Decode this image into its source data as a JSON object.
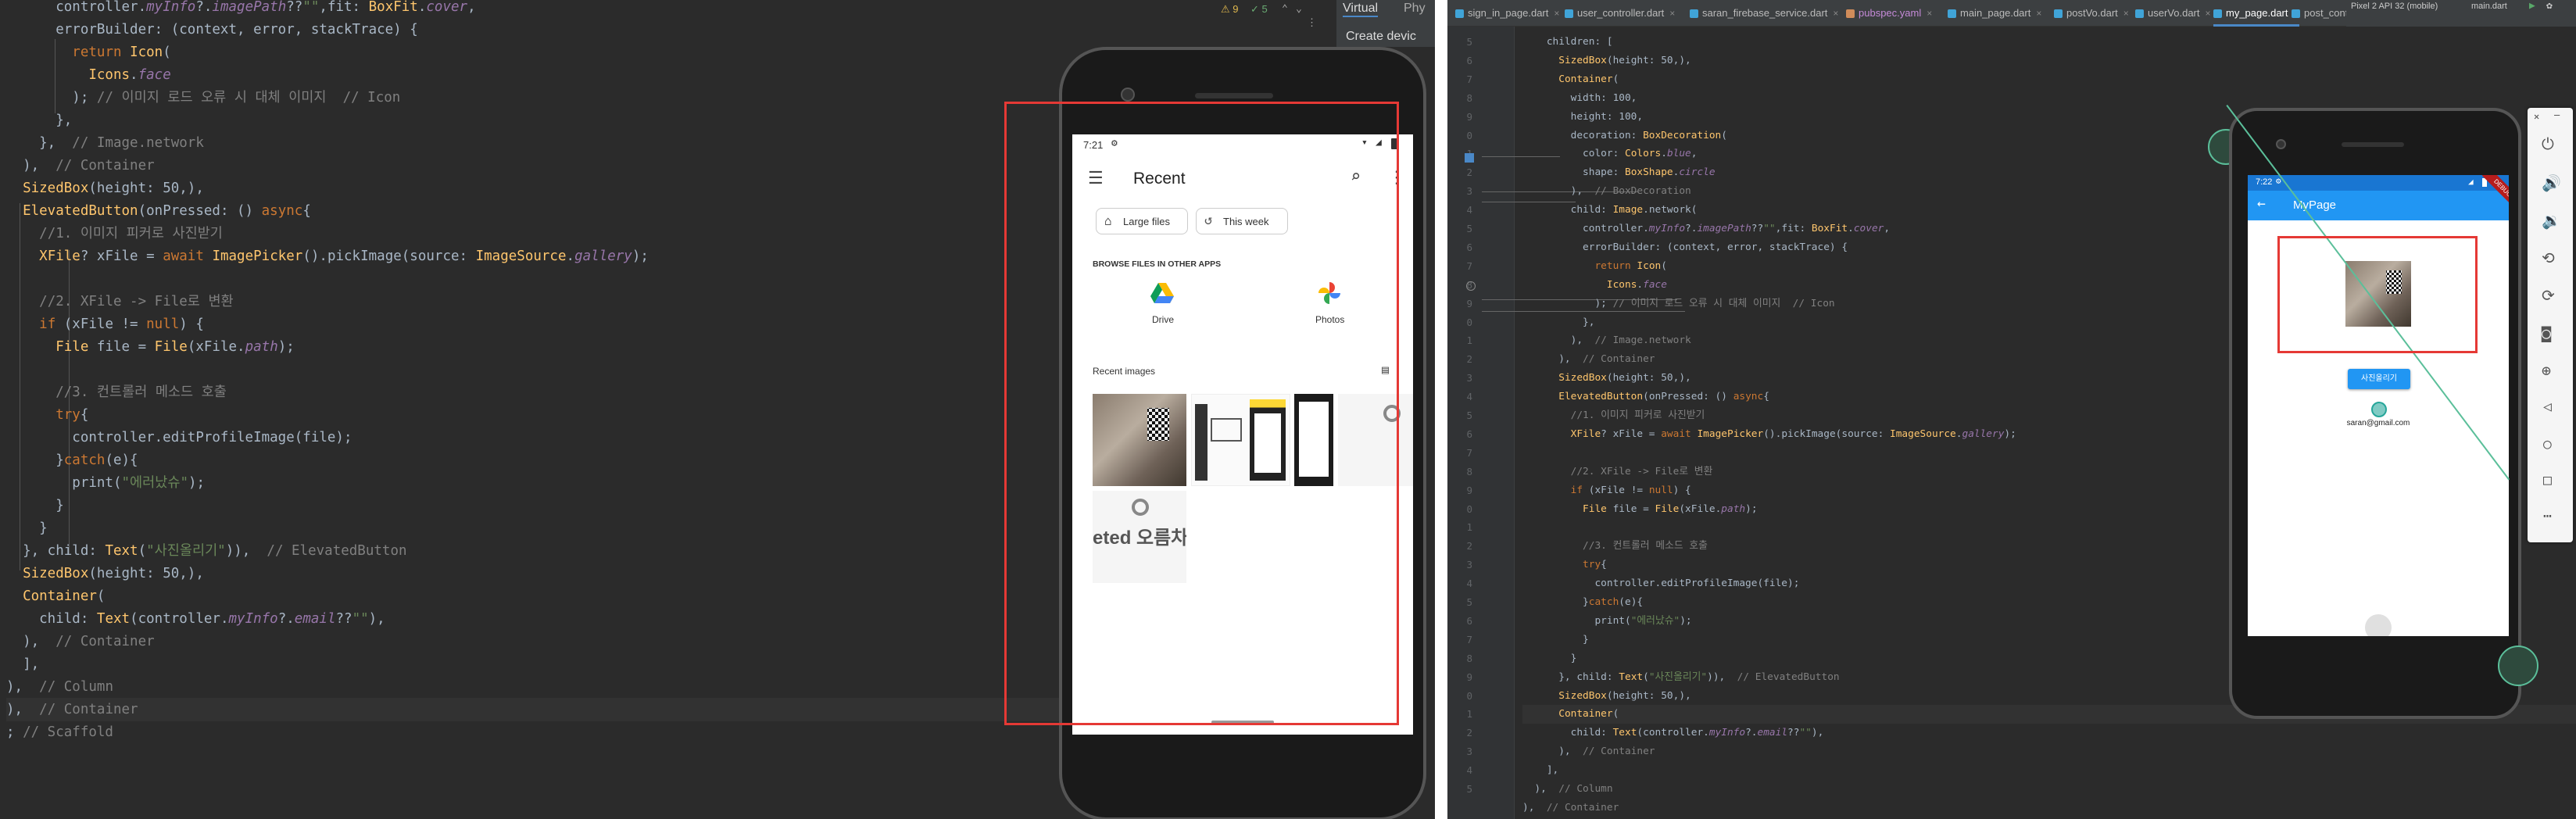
{
  "left_pane": {
    "top_status": {
      "warnings": "⚠ 9",
      "checks": "✓ 5",
      "tab_virtual": "Virtual",
      "tab_phys": "Phy",
      "create_device": "Create devic"
    },
    "code_lines": [
      "      controller.myInfo?.imagePath??\"\",fit: BoxFit.cover,",
      "      errorBuilder: (context, error, stackTrace) {",
      "        return Icon(",
      "          Icons.face",
      "        ); // 이미지 로드 오류 시 대체 이미지  // Icon",
      "      },",
      "    },  // Image.network",
      "  ),  // Container",
      "  SizedBox(height: 50,),",
      "  ElevatedButton(onPressed: () async{",
      "    //1. 이미지 피커로 사진받기",
      "    XFile? xFile = await ImagePicker().pickImage(source: ImageSource.gallery);",
      "",
      "    //2. XFile -> File로 변환",
      "    if (xFile != null) {",
      "      File file = File(xFile.path);",
      "",
      "      //3. 컨트롤러 메소드 호출",
      "      try{",
      "        controller.editProfileImage(file);",
      "      }catch(e){",
      "        print(\"에러났슈\");",
      "      }",
      "    }",
      "  }, child: Text(\"사진올리기\")),  // ElevatedButton",
      "  SizedBox(height: 50,),",
      "  Container(",
      "    child: Text(controller.myInfo?.email??\"\"),",
      "  ),  // Container",
      "  ],",
      "),  // Column",
      "),  // Container",
      "; // Scaffold"
    ],
    "phone": {
      "time": "7:21",
      "header": "Recent",
      "chip_large": "Large files",
      "chip_week": "This week",
      "browse_label": "BROWSE FILES IN OTHER APPS",
      "app_drive": "Drive",
      "app_photos": "Photos",
      "recent_images": "Recent images",
      "thumb_text": "eted 오름차"
    }
  },
  "right_pane": {
    "tabs": [
      "sign_in_page.dart",
      "user_controller.dart",
      "saran_firebase_service.dart",
      "pubspec.yaml",
      "main_page.dart",
      "postVo.dart",
      "userVo.dart",
      "my_page.dart",
      "post_controller.dart"
    ],
    "active_tab": "my_page.dart",
    "device_selector": "Pixel 2 API 32 (mobile)",
    "branch_selector": "main.dart",
    "line_numbers": [
      "5",
      "6",
      "7",
      "8",
      "9",
      "0",
      "1",
      "2",
      "3",
      "4",
      "5",
      "6",
      "7",
      "8",
      "9",
      "0",
      "1",
      "2",
      "3",
      "4",
      "5",
      "6",
      "7",
      "8",
      "9",
      "0",
      "1",
      "2",
      "3",
      "4",
      "5",
      "6",
      "7",
      "8",
      "9",
      "0",
      "1",
      "2",
      "3",
      "4",
      "5"
    ],
    "code_lines": [
      "    children: [",
      "      SizedBox(height: 50,),",
      "      Container(",
      "        width: 100,",
      "        height: 100,",
      "        decoration: BoxDecoration(",
      "          color: Colors.blue,",
      "          shape: BoxShape.circle",
      "        ),  // BoxDecoration",
      "        child: Image.network(",
      "          controller.myInfo?.imagePath??\"\",fit: BoxFit.cover,",
      "          errorBuilder: (context, error, stackTrace) {",
      "            return Icon(",
      "              Icons.face",
      "            ); // 이미지 로드 오류 시 대체 이미지  // Icon",
      "          },",
      "        ),  // Image.network",
      "      ),  // Container",
      "      SizedBox(height: 50,),",
      "      ElevatedButton(onPressed: () async{",
      "        //1. 이미지 피커로 사진받기",
      "        XFile? xFile = await ImagePicker().pickImage(source: ImageSource.gallery);",
      "",
      "        //2. XFile -> File로 변환",
      "        if (xFile != null) {",
      "          File file = File(xFile.path);",
      "",
      "          //3. 컨트롤러 메소드 호출",
      "          try{",
      "            controller.editProfileImage(file);",
      "          }catch(e){",
      "            print(\"에러났슈\");",
      "          }",
      "        }",
      "      }, child: Text(\"사진올리기\")),  // ElevatedButton",
      "      SizedBox(height: 50,),",
      "      Container(",
      "        child: Text(controller.myInfo?.email??\"\"),",
      "      ),  // Container",
      "    ],",
      "  ),  // Column",
      "),  // Container"
    ],
    "phone": {
      "time": "7:22",
      "title": "MyPage",
      "button": "사진올리기",
      "email": "saran@gmail.com",
      "debug": "DEBUG"
    }
  },
  "colors": {
    "editor_bg": "#2b2b2b",
    "keyword": "#cc7832",
    "type": "#ffc66d",
    "string": "#6a8759",
    "comment": "#808080",
    "field": "#9876aa",
    "text": "#a9b7c6",
    "appbar": "#2196f3",
    "red_box": "#e53935"
  },
  "icons": [
    "menu-icon",
    "search-icon",
    "more-vert-icon",
    "tag-icon",
    "history-icon",
    "drive-icon",
    "photos-icon",
    "list-view-icon",
    "back-arrow-icon",
    "power-icon",
    "volume-up-icon",
    "volume-down-icon",
    "rotate-icon",
    "camera-icon",
    "zoom-icon",
    "back-icon",
    "home-icon",
    "overview-icon",
    "more-icon"
  ]
}
